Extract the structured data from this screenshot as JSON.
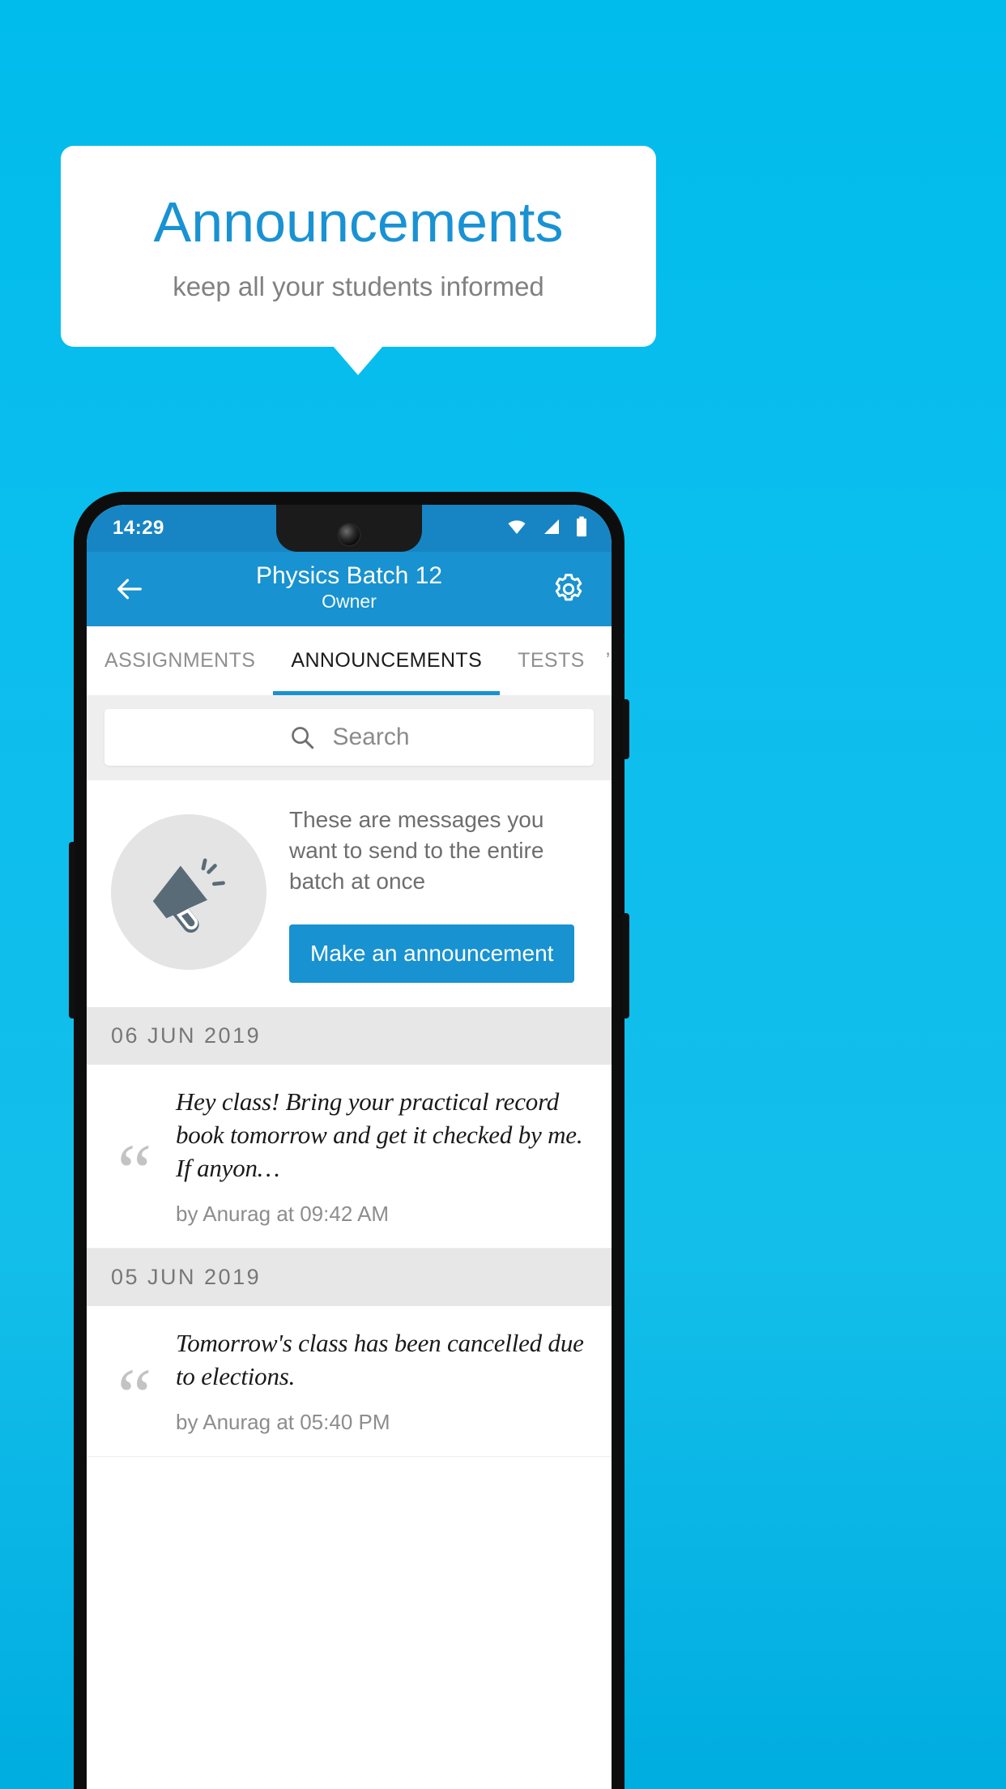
{
  "promo_banner": {
    "title": "Announcements",
    "subtitle": "keep all your students informed"
  },
  "phone": {
    "status_bar": {
      "time": "14:29",
      "icons": [
        "wifi-icon",
        "cellular-signal-icon",
        "battery-icon"
      ]
    },
    "toolbar": {
      "back_icon": "back-arrow-icon",
      "title": "Physics Batch 12",
      "subtitle": "Owner",
      "settings_icon": "gear-icon"
    },
    "tabs": [
      {
        "label": "ASSIGNMENTS",
        "active": false
      },
      {
        "label": "ANNOUNCEMENTS",
        "active": true
      },
      {
        "label": "TESTS",
        "active": false
      },
      {
        "label": "’",
        "active": false
      }
    ],
    "search": {
      "icon": "search-icon",
      "placeholder": "Search",
      "value": ""
    },
    "empty_promo": {
      "icon": "megaphone-icon",
      "description": "These are messages you want to send to the entire batch at once",
      "button_label": "Make an announcement"
    },
    "announcement_groups": [
      {
        "date": "06  JUN  2019",
        "items": [
          {
            "text": "Hey class! Bring your practical record book tomorrow and get it checked by me. If anyon…",
            "meta": "by Anurag at 09:42 AM"
          }
        ]
      },
      {
        "date": "05  JUN  2019",
        "items": [
          {
            "text": "Tomorrow's class has been cancelled due to elections.",
            "meta": "by Anurag at 05:40 PM"
          }
        ]
      }
    ]
  },
  "colors": {
    "background_blue": "#0CBEEE",
    "brand_blue": "#1892D0",
    "status_bar_blue": "#1785C4",
    "title_blue": "#1992D4",
    "muted_gray": "#8d8d8d",
    "date_band_gray": "#e7e7e7"
  }
}
